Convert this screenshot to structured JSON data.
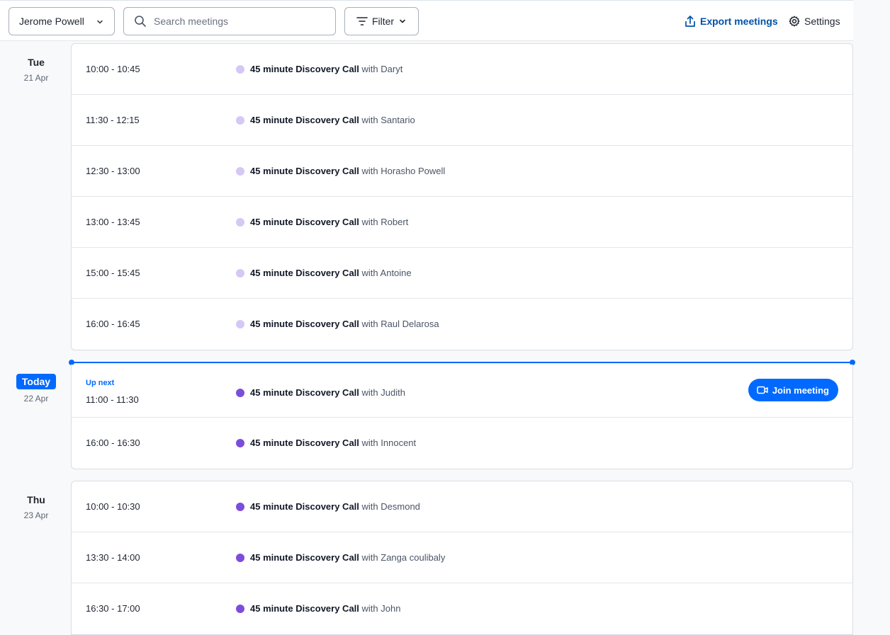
{
  "toolbar": {
    "user_select": "Jerome Powell",
    "search_placeholder": "Search meetings",
    "filter_label": "Filter",
    "export_label": "Export meetings",
    "settings_label": "Settings"
  },
  "colors": {
    "accent": "#0069ff",
    "past_dot": "#d6c8f5",
    "upcoming_dot": "#7c4ddb"
  },
  "days": [
    {
      "dow": "Tue",
      "date": "21 Apr",
      "meetings": [
        {
          "time": "10:00 - 10:45",
          "event": "45 minute Discovery Call",
          "with": "with Daryt"
        },
        {
          "time": "11:30 - 12:15",
          "event": "45 minute Discovery Call",
          "with": "with Santario"
        },
        {
          "time": "12:30 - 13:00",
          "event": "45 minute Discovery Call",
          "with": "with Horasho Powell"
        },
        {
          "time": "13:00 - 13:45",
          "event": "45 minute Discovery Call",
          "with": "with Robert"
        },
        {
          "time": "15:00 - 15:45",
          "event": "45 minute Discovery Call",
          "with": "with Antoine"
        },
        {
          "time": "16:00 - 16:45",
          "event": "45 minute Discovery Call",
          "with": "with Raul Delarosa"
        }
      ]
    },
    {
      "dow": "Today",
      "date": "22 Apr",
      "up_next_label": "Up next",
      "join_label": "Join meeting",
      "meetings": [
        {
          "time": "11:00 - 11:30",
          "event": "45 minute Discovery Call",
          "with": "with Judith"
        },
        {
          "time": "16:00 - 16:30",
          "event": "45 minute Discovery Call",
          "with": "with Innocent"
        }
      ]
    },
    {
      "dow": "Thu",
      "date": "23 Apr",
      "meetings": [
        {
          "time": "10:00 - 10:30",
          "event": "45 minute Discovery Call",
          "with": "with Desmond"
        },
        {
          "time": "13:30 - 14:00",
          "event": "45 minute Discovery Call",
          "with": "with Zanga coulibaly"
        },
        {
          "time": "16:30 - 17:00",
          "event": "45 minute Discovery Call",
          "with": "with John"
        }
      ]
    }
  ]
}
